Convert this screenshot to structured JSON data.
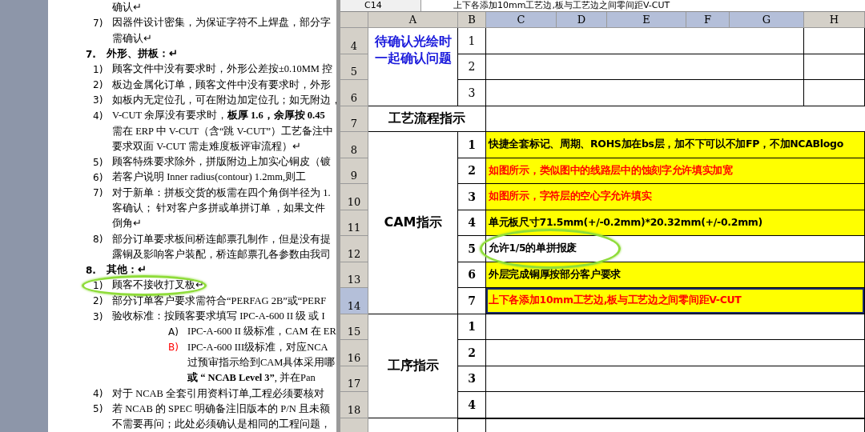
{
  "document": {
    "lines": [
      {
        "kind": "cont",
        "text": "确认↵"
      },
      {
        "kind": "item",
        "marker": "7)",
        "text": "因器件设计密集，为保证字符不上焊盘，部分字"
      },
      {
        "kind": "cont",
        "text": "需确认↵"
      },
      {
        "kind": "heading",
        "marker": "7.",
        "text": "外形、拼板：↵"
      },
      {
        "kind": "item",
        "marker": "1)",
        "text": "顾客文件中没有要求时，外形公差按±0.10MM 控"
      },
      {
        "kind": "item",
        "marker": "2)",
        "text": "板边金属化订单，顾客文件中没有要求时，外形"
      },
      {
        "kind": "item",
        "marker": "3)",
        "text": "如板内无定位孔，可在附边加定位孔；如无附边，"
      },
      {
        "kind": "item",
        "marker": "4)",
        "text": "V-CUT 余厚没有要求时，**板厚 1.6，余厚按 0.45**"
      },
      {
        "kind": "cont",
        "text": "需在 ERP 中 V-CUT（含“跳 V-CUT”）工艺备注中"
      },
      {
        "kind": "cont",
        "text": "要求双面 V-CUT 需走难度板评审流程）↵"
      },
      {
        "kind": "item",
        "marker": "5)",
        "text": "顾客特殊要求除外，拼版附边上加实心铜皮（镀"
      },
      {
        "kind": "item",
        "marker": "6)",
        "text": "若客户说明 Inner radius(contour) 1.2mm,则工"
      },
      {
        "kind": "item",
        "marker": "7)",
        "text": "对于新单：拼板交货的板需在四个角倒半径为 1."
      },
      {
        "kind": "cont",
        "text": "客确认； 针对客户多拼或单拼订单 ，如果文件"
      },
      {
        "kind": "cont",
        "text": "倒角↵"
      },
      {
        "kind": "item",
        "marker": "8)",
        "text": "部分订单要求板间桥连邮票孔制作，但是没有提"
      },
      {
        "kind": "cont",
        "text": "露铜及影响客户装配，桥连邮票孔各参数由我司"
      },
      {
        "kind": "heading",
        "marker": "8.",
        "text": "其他：↵"
      },
      {
        "kind": "item",
        "marker": "1)",
        "text": "顾客不接收打叉板↵",
        "annotated": true
      },
      {
        "kind": "item",
        "marker": "2)",
        "text": "部分订单客户要求需符合“PERFAG 2B”或“PERF"
      },
      {
        "kind": "item",
        "marker": "3)",
        "text": "验收标准：按顾客要求填写 IPC-A-600 II 级 或 I"
      },
      {
        "kind": "sub",
        "marker": "A)",
        "color": "#000000",
        "text": "IPC-A-600 II 级标准，CAM 在 ER"
      },
      {
        "kind": "sub",
        "marker": "B)",
        "color": "#ff0000",
        "text": "IPC-A-600 III级标准，对应NCA"
      },
      {
        "kind": "subcont",
        "text": "过预审指示给到CAM具体采用哪"
      },
      {
        "kind": "subcont",
        "text": "**或 “ NCAB Level 3”**, 并在Pan"
      },
      {
        "kind": "item",
        "marker": "4)",
        "text": "对于 NCAB 全套引用资料订单,工程必须要核对"
      },
      {
        "kind": "item",
        "marker": "5)",
        "text": "若 NCAB 的 SPEC 明确备注旧版本的 P/N 且未额"
      },
      {
        "kind": "cont",
        "text": "不需要再问；此处必须确认是相同的工程问题，"
      }
    ]
  },
  "spreadsheet": {
    "name_box": "C14",
    "formula": "上下各添加10mm工艺边,板与工艺边之间零间距V-CUT",
    "columns": [
      {
        "label": "A",
        "selected": false
      },
      {
        "label": "B",
        "selected": false
      },
      {
        "label": "C",
        "selected": true
      },
      {
        "label": "D",
        "selected": true
      },
      {
        "label": "E",
        "selected": true
      },
      {
        "label": "F",
        "selected": true
      },
      {
        "label": "G",
        "selected": true
      },
      {
        "label": "H",
        "selected": false
      }
    ],
    "rows": [
      {
        "label": "4",
        "selected": false
      },
      {
        "label": "5",
        "selected": false
      },
      {
        "label": "6",
        "selected": false
      },
      {
        "label": "7",
        "selected": false
      },
      {
        "label": "8",
        "selected": false
      },
      {
        "label": "9",
        "selected": false
      },
      {
        "label": "10",
        "selected": false
      },
      {
        "label": "11",
        "selected": false
      },
      {
        "label": "12",
        "selected": false
      },
      {
        "label": "13",
        "selected": false
      },
      {
        "label": "14",
        "selected": true
      },
      {
        "label": "15",
        "selected": false
      },
      {
        "label": "16",
        "selected": false
      },
      {
        "label": "17",
        "selected": false
      },
      {
        "label": "18",
        "selected": false
      }
    ],
    "sections": [
      {
        "kind": "pending",
        "label": "待确认光绘时一起确认问题",
        "items": [
          {
            "no": "1",
            "selected": false
          },
          {
            "no": "2",
            "selected": false
          },
          {
            "no": "3",
            "selected": false
          }
        ]
      },
      {
        "kind": "heading",
        "label": "工艺流程指示"
      },
      {
        "kind": "cam",
        "label": "CAM指示",
        "items": [
          {
            "no": "1",
            "text": "快捷全套标记、周期、ROHS加在bs层，加不下可以不加FP，不加NCABlogo",
            "color": "#000000",
            "highlighted": true,
            "selected": false
          },
          {
            "no": "2",
            "text": "如图所示，类似图中的线路层中的蚀刻字允许填实加宽",
            "color": "#ff0000",
            "highlighted": true,
            "selected": false
          },
          {
            "no": "3",
            "text": "如图所示，字符层的空心字允许填实",
            "color": "#ff0000",
            "highlighted": true,
            "selected": false
          },
          {
            "no": "4",
            "text": "单元板尺寸71.5mm(+/-0.2mm)*20.32mm(+/-0.2mm)",
            "color": "#000000",
            "highlighted": true,
            "selected": false
          },
          {
            "no": "5",
            "text": "允许1/5的单拼报废",
            "color": "#000000",
            "highlighted": false,
            "selected": false,
            "annotated": true
          },
          {
            "no": "6",
            "text": "外层完成铜厚按部分客户要求",
            "color": "#000000",
            "highlighted": true,
            "selected": false
          },
          {
            "no": "7",
            "text": "上下各添加10mm工艺边,板与工艺边之间零间距V-CUT",
            "color": "#ff0000",
            "highlighted": true,
            "selected": true
          }
        ]
      },
      {
        "kind": "process",
        "label": "工序指示",
        "items": [
          {
            "no": "1",
            "selected": false
          },
          {
            "no": "2",
            "selected": false
          },
          {
            "no": "3",
            "selected": false
          },
          {
            "no": "4",
            "selected": false
          }
        ]
      }
    ]
  }
}
